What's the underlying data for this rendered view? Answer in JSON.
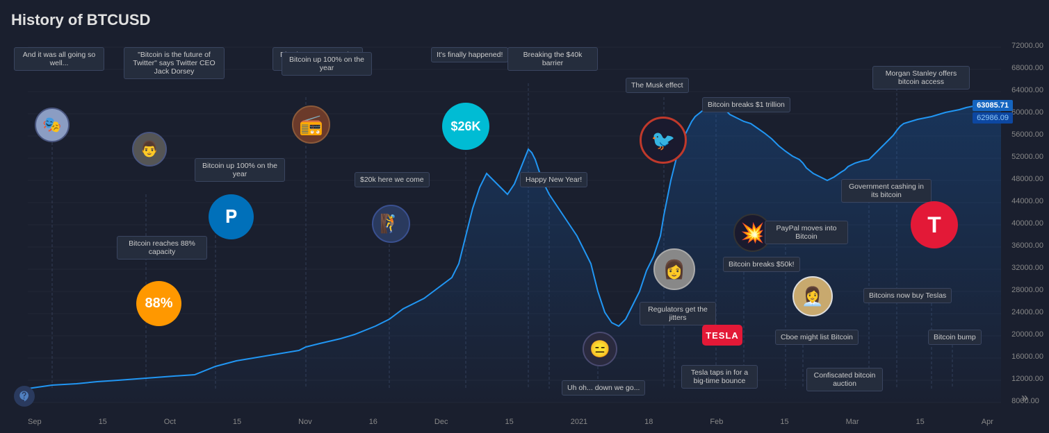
{
  "title": "History of BTCUSD",
  "chart": {
    "y_axis_labels": [
      "72000.00",
      "68000.00",
      "64000.00",
      "60000.00",
      "56000.00",
      "52000.00",
      "48000.00",
      "44000.00",
      "40000.00",
      "36000.00",
      "32000.00",
      "28000.00",
      "24000.00",
      "20000.00",
      "16000.00",
      "12000.00",
      "8000.00"
    ],
    "x_axis_labels": [
      "Sep",
      "15",
      "Oct",
      "15",
      "Nov",
      "16",
      "Dec",
      "15",
      "2021",
      "18",
      "Feb",
      "15",
      "Mar",
      "15",
      "Apr"
    ],
    "current_price_1": "63085.71",
    "current_price_2": "62986.09"
  },
  "annotations": [
    {
      "id": "ann1",
      "label": "And it was all going so well..."
    },
    {
      "id": "ann2",
      "label": "\"Bitcoin is the future of Twitter\" says Twitter CEO Jack Dorsey"
    },
    {
      "id": "ann3",
      "label": "Bitcoin up 100% on the year"
    },
    {
      "id": "ann4",
      "label": "PayPal accepts Bitcoin, price hits record high"
    },
    {
      "id": "ann5",
      "label": "$20k here we come"
    },
    {
      "id": "ann6",
      "label": "It's finally happened!"
    },
    {
      "id": "ann7",
      "label": "Breaking the $40k barrier"
    },
    {
      "id": "ann8",
      "label": "Happy New Year!"
    },
    {
      "id": "ann9",
      "label": "Uh oh... down we go..."
    },
    {
      "id": "ann10",
      "label": "The Musk effect"
    },
    {
      "id": "ann11",
      "label": "Bitcoin breaks $1 trillion"
    },
    {
      "id": "ann12",
      "label": "Regulators get the jitters"
    },
    {
      "id": "ann13",
      "label": "Bitcoin breaks $50k!"
    },
    {
      "id": "ann14",
      "label": "Tesla taps in for a big-time bounce"
    },
    {
      "id": "ann15",
      "label": "PayPal moves into Bitcoin"
    },
    {
      "id": "ann16",
      "label": "Cboe might list Bitcoin"
    },
    {
      "id": "ann17",
      "label": "Confiscated bitcoin auction"
    },
    {
      "id": "ann18",
      "label": "Government cashing in its bitcoin"
    },
    {
      "id": "ann19",
      "label": "Morgan Stanley offers bitcoin access"
    },
    {
      "id": "ann20",
      "label": "Bitcoins now buy Teslas"
    },
    {
      "id": "ann21",
      "label": "Bitcoin bump"
    },
    {
      "id": "ann22",
      "label": "Bitcoin reaches 88% capacity"
    }
  ],
  "badges": [
    {
      "id": "b1",
      "label": "$26K",
      "color": "#00bcd4"
    },
    {
      "id": "b2",
      "label": "88%",
      "color": "#ff9800"
    }
  ],
  "nav": {
    "arrow": "»"
  },
  "watermark": "₿"
}
